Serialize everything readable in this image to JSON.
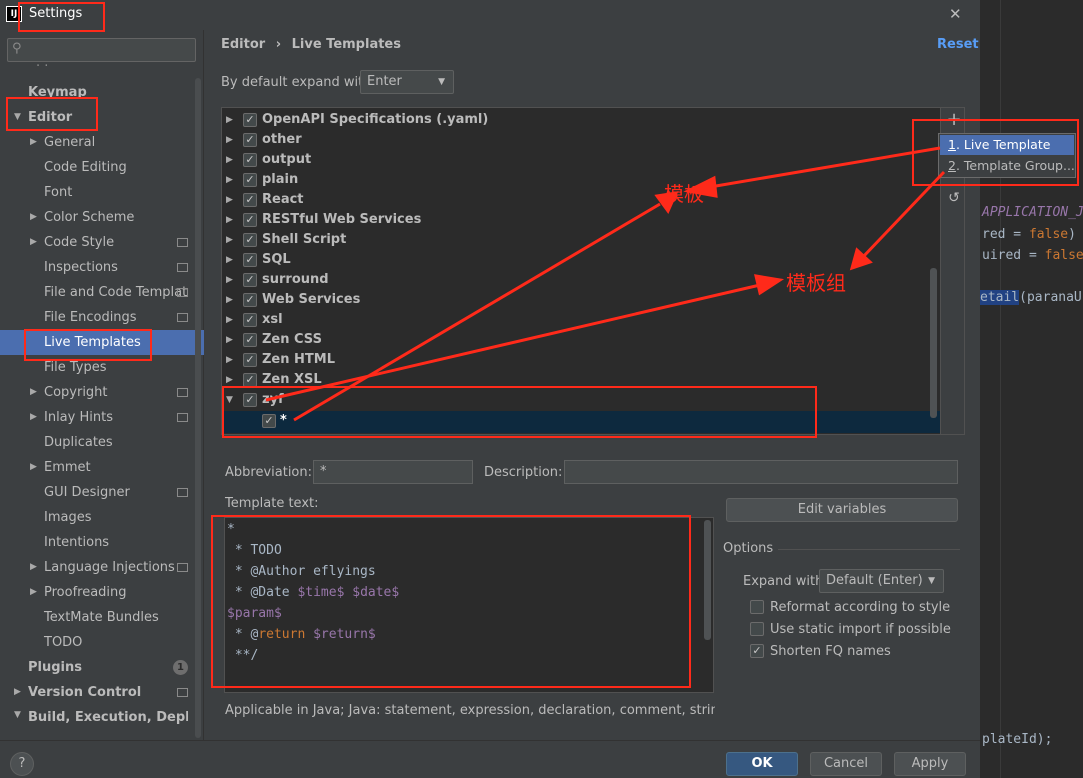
{
  "window": {
    "title": "Settings",
    "close": "✕"
  },
  "search": {
    "placeholder": ""
  },
  "sidebar": {
    "dots": "· ·",
    "items": [
      {
        "label": "Keymap"
      },
      {
        "label": "Editor"
      },
      {
        "label": "General"
      },
      {
        "label": "Code Editing"
      },
      {
        "label": "Font"
      },
      {
        "label": "Color Scheme"
      },
      {
        "label": "Code Style"
      },
      {
        "label": "Inspections"
      },
      {
        "label": "File and Code Templat"
      },
      {
        "label": "File Encodings"
      },
      {
        "label": "Live Templates"
      },
      {
        "label": "File Types"
      },
      {
        "label": "Copyright"
      },
      {
        "label": "Inlay Hints"
      },
      {
        "label": "Duplicates"
      },
      {
        "label": "Emmet"
      },
      {
        "label": "GUI Designer"
      },
      {
        "label": "Images"
      },
      {
        "label": "Intentions"
      },
      {
        "label": "Language Injections"
      },
      {
        "label": "Proofreading"
      },
      {
        "label": "TextMate Bundles"
      },
      {
        "label": "TODO"
      },
      {
        "label": "Plugins",
        "badge": "1"
      },
      {
        "label": "Version Control"
      },
      {
        "label": "Build, Execution, Deploym"
      }
    ]
  },
  "header": {
    "breadcrumb_parent": "Editor",
    "breadcrumb_sep": "›",
    "breadcrumb_current": "Live Templates",
    "reset": "Reset"
  },
  "expand": {
    "label": "By default expand with",
    "value": "Enter"
  },
  "tree": {
    "groups": [
      {
        "label": "OpenAPI Specifications (.yaml)"
      },
      {
        "label": "other"
      },
      {
        "label": "output"
      },
      {
        "label": "plain"
      },
      {
        "label": "React"
      },
      {
        "label": "RESTful Web Services"
      },
      {
        "label": "Shell Script"
      },
      {
        "label": "SQL"
      },
      {
        "label": "surround"
      },
      {
        "label": "Web Services"
      },
      {
        "label": "xsl"
      },
      {
        "label": "Zen CSS"
      },
      {
        "label": "Zen HTML"
      },
      {
        "label": "Zen XSL"
      },
      {
        "label": "zyf"
      }
    ],
    "child": "*",
    "check": "✓"
  },
  "popup": {
    "items": [
      {
        "num": "1",
        "label": ". Live Template"
      },
      {
        "num": "2",
        "label": ". Template Group..."
      }
    ]
  },
  "abbreviation": {
    "label": "Abbreviation:",
    "value": "*"
  },
  "description": {
    "label": "Description:",
    "value": ""
  },
  "template_text": {
    "label": "Template text:"
  },
  "edit_variables": "Edit variables",
  "options": {
    "title": "Options",
    "expand_label": "Expand with",
    "expand_value": "Default (Enter)",
    "reformat": "Reformat according to style",
    "static_import": "Use static import if possible",
    "shorten": "Shorten FQ names"
  },
  "applicable": "Applicable in Java; Java: statement, expression, declaration, comment, string, smart t",
  "buttons": {
    "ok": "OK",
    "cancel": "Cancel",
    "apply": "Apply",
    "help": "?"
  },
  "annotations": {
    "template": "模板",
    "group": "模板组"
  },
  "code_fragments": {
    "l1": "APPLICATION_J",
    "l2a": "red = ",
    "l2b": "false",
    "l2c": ")",
    "l3a": "uired = ",
    "l3b": "false",
    "l4a": "etail",
    "l4b": "(paranaU",
    "l5": "plateId);"
  },
  "colors": {
    "accent": "#4b6eaf",
    "annotation_red": "#ff2a1a",
    "var": "#9876aa",
    "keyword": "#cc7832"
  }
}
